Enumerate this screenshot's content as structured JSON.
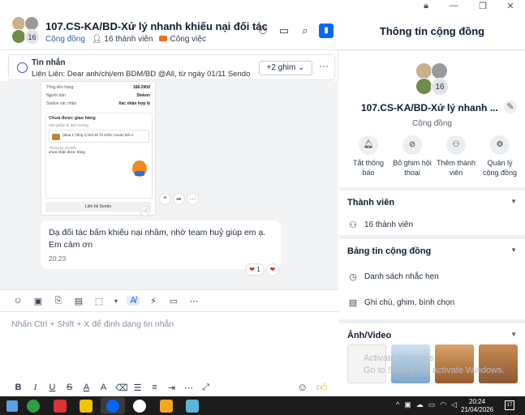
{
  "window": {
    "lock_icon": "lock-icon",
    "minimize": "—",
    "restore": "❐",
    "close": "✕"
  },
  "header": {
    "group_name": "107.CS-KA/BD-Xử lý nhanh khiếu nại đối tác",
    "avatar_count": "16",
    "community_label": "Cộng đồng",
    "members_label": "16 thành viên",
    "work_label": "Công việc"
  },
  "pinned": {
    "title": "Tin nhắn",
    "text": "Liên Liên: Dear anh/chị/em BDM/BD @All, từ ngày 01/11 Sendo Far...",
    "pin_button": "+2 ghim ⌄",
    "more": "···"
  },
  "image_message": {
    "rows": [
      {
        "label": "Tổng tiền hàng",
        "value": "168.290đ"
      },
      {
        "label": "Người bán",
        "value": "Stekon"
      },
      {
        "label": "Station xác nhận",
        "value": "Xác nhận hợp lệ"
      }
    ],
    "status_title": "Chưa được giao hàng",
    "related_label": "Sản phẩm bị ảnh hưởng",
    "product_text": "(Mua 1 Tặng 1) Đôi Bí Ối Kiếm Vouan Đôi ri",
    "detail_label": "Thông tin chi tiết",
    "detail_value": "chưa nhận được hàng",
    "contact_button": "Liên hệ Sendo"
  },
  "text_message": {
    "text": "Dạ đối tác bấm khiếu nại nhầm, nhờ team huỷ giúp em ạ. Em cảm ơn",
    "time": "20:23",
    "reaction_count": "1"
  },
  "composer": {
    "placeholder": "Nhấn Ctrl + Shift + X để định dạng tin nhắn"
  },
  "info": {
    "title": "Thông tin cộng đồng",
    "name": "107.CS-KA/BD-Xử lý nhanh ...",
    "avatar_count": "16",
    "type": "Cộng đồng",
    "actions": [
      {
        "label": "Tắt thông báo",
        "icon": "bell-icon"
      },
      {
        "label": "Bỏ ghim hội thoại",
        "icon": "unpin-icon"
      },
      {
        "label": "Thêm thành viên",
        "icon": "add-member-icon"
      },
      {
        "label": "Quản lý cộng đồng",
        "icon": "settings-icon"
      }
    ],
    "members_section": {
      "title": "Thành viên",
      "item": "16 thành viên"
    },
    "board_section": {
      "title": "Bảng tin cộng đồng",
      "items": [
        "Danh sách nhắc hẹn",
        "Ghi chú, ghim, bình chọn"
      ]
    },
    "media_section": {
      "title": "Ảnh/Video",
      "watermark_1": "Activate Windows",
      "watermark_2": "Go to Settings to activate Windows."
    }
  },
  "taskbar": {
    "time": "20:24",
    "date": "21/04/2026",
    "notifications": "17"
  },
  "colors": {
    "accent": "#0068ff",
    "orange_tag": "#f26b1d",
    "heart": "#e02424"
  }
}
